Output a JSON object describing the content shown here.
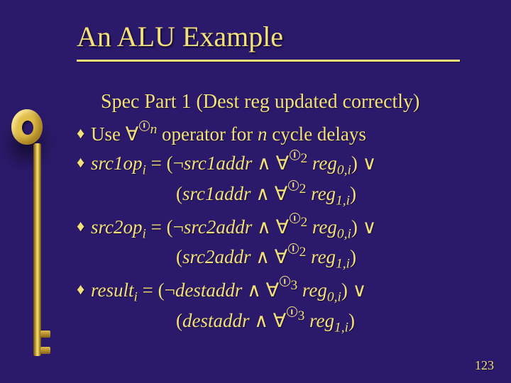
{
  "title": "An ALU Example",
  "subtitle": "Spec Part 1 (Dest reg updated correctly)",
  "bullets": {
    "b1": {
      "pre": "Use ",
      "fa": "∀",
      "sup": "n",
      "post_html": " operator for <span class=\"it\">n</span> cycle delays"
    },
    "b2": {
      "lhs": "src1op",
      "lhs_sub": "i",
      "eq": " = (",
      "neg": "¬",
      "t1": "src1addr",
      "and": " ∧ ",
      "fa": "∀",
      "sup": "2",
      "r0a": " reg",
      "r0s": "0,",
      "r0i": "i",
      "close_or": ") ∨",
      "line2_open": "(",
      "t2": "src1addr",
      "and2": " ∧ ",
      "fa2": "∀",
      "sup2": "2",
      "r1a": " reg",
      "r1s": "1,",
      "r1i": "i",
      "close": ")"
    },
    "b3": {
      "lhs": "src2op",
      "lhs_sub": "i",
      "eq": " = (",
      "neg": "¬",
      "t1": "src2addr",
      "and": " ∧ ",
      "fa": "∀",
      "sup": "2",
      "r0a": " reg",
      "r0s": "0,",
      "r0i": "i",
      "close_or": ") ∨",
      "line2_open": "(",
      "t2": "src2addr",
      "and2": " ∧ ",
      "fa2": "∀",
      "sup2": "2",
      "r1a": " reg",
      "r1s": "1,",
      "r1i": "i",
      "close": ")"
    },
    "b4": {
      "lhs": "result",
      "lhs_sub": "i",
      "eq": " = (",
      "neg": "¬",
      "t1": "destaddr",
      "and": " ∧ ",
      "fa": "∀",
      "sup": "3",
      "r0a": " reg",
      "r0s": "0,",
      "r0i": "i",
      "close_or": ") ∨",
      "line2_open": "(",
      "t2": "destaddr",
      "and2": " ∧ ",
      "fa2": "∀",
      "sup2": "3",
      "r1a": " reg",
      "r1s": "1,",
      "r1i": "i",
      "close": ")"
    }
  },
  "page_number": "123"
}
